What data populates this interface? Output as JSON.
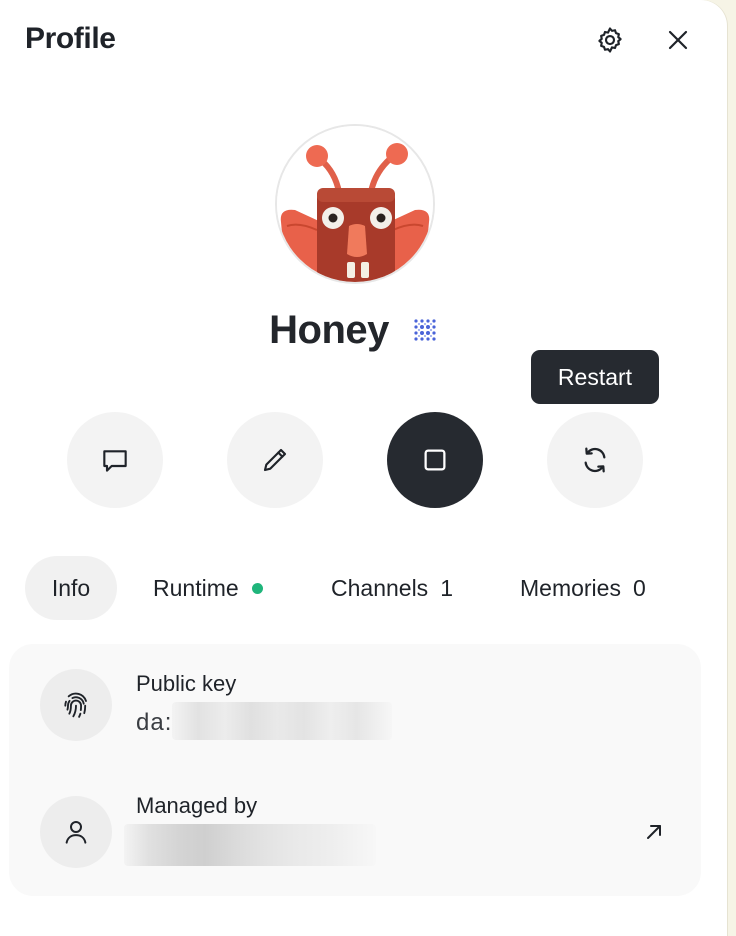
{
  "header": {
    "title": "Profile",
    "settings_icon": "gear-icon",
    "close_icon": "close-icon"
  },
  "agent": {
    "name": "Honey",
    "avatar": "red-antenna-creature-avatar",
    "badge_icon": "dotted-grid-badge-icon",
    "badge_color": "#4a63d8"
  },
  "actions": {
    "tooltip": "Restart",
    "chat_icon": "chat-bubble-icon",
    "edit_icon": "pencil-icon",
    "stop_icon": "stop-square-icon",
    "restart_icon": "refresh-icon"
  },
  "tabs": [
    {
      "label": "Info",
      "active": true
    },
    {
      "label": "Runtime",
      "status": "online",
      "status_color": "#1fb57b"
    },
    {
      "label": "Channels",
      "count": "1"
    },
    {
      "label": "Memories",
      "count": "0"
    }
  ],
  "info": {
    "public_key_label": "Public key",
    "public_key_value": "da:",
    "public_key_icon": "fingerprint-icon",
    "managed_by_label": "Managed by",
    "managed_by_icon": "user-icon",
    "open_icon": "arrow-up-right-icon"
  },
  "colors": {
    "accent_dark": "#262a30",
    "card_bg": "#f9f9f9",
    "button_bg": "#f3f3f3"
  }
}
